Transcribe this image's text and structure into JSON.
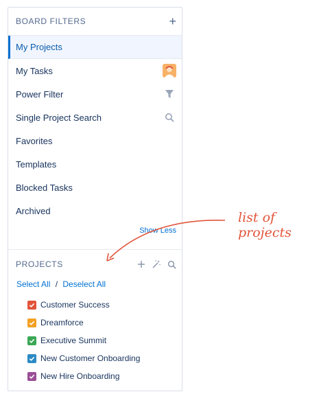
{
  "board_filters": {
    "title": "BOARD FILTERS",
    "add_icon": "plus-icon",
    "items": [
      {
        "label": "My Projects",
        "icon": null,
        "active": true
      },
      {
        "label": "My Tasks",
        "icon": "avatar-icon"
      },
      {
        "label": "Power Filter",
        "icon": "funnel-icon"
      },
      {
        "label": "Single Project Search",
        "icon": "search-icon"
      },
      {
        "label": "Favorites",
        "icon": null
      },
      {
        "label": "Templates",
        "icon": null
      },
      {
        "label": "Blocked Tasks",
        "icon": null
      },
      {
        "label": "Archived",
        "icon": null
      }
    ],
    "show_less": "Show Less"
  },
  "projects": {
    "title": "PROJECTS",
    "select_all": "Select All",
    "separator": "/",
    "deselect_all": "Deselect All",
    "items": [
      {
        "label": "Customer Success",
        "color": "#e2543a"
      },
      {
        "label": "Dreamforce",
        "color": "#f2a124"
      },
      {
        "label": "Executive Summit",
        "color": "#3ba755"
      },
      {
        "label": "New Customer Onboarding",
        "color": "#2b8ac3"
      },
      {
        "label": "New Hire Onboarding",
        "color": "#9b4f96"
      }
    ]
  },
  "annotation": {
    "text": "list of projects",
    "color": "#e2543a"
  },
  "colors": {
    "accent": "#0070d2",
    "active_bg": "#f0f5ff",
    "border": "#d8dde6"
  }
}
